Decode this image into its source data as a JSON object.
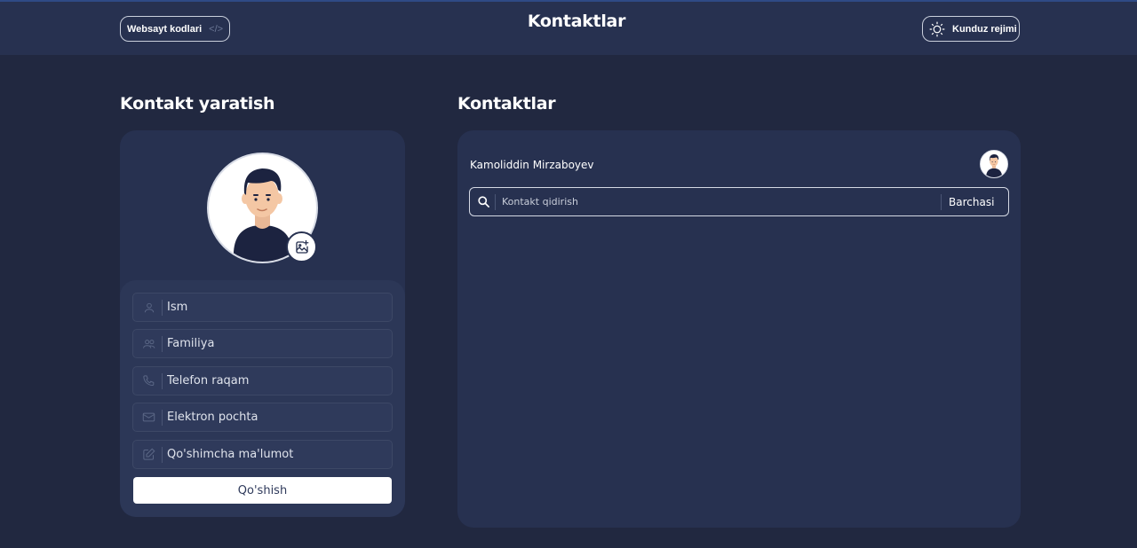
{
  "header": {
    "title": "Kontaktlar",
    "code_button_label": "Websayt kodlari",
    "code_icon": "</>",
    "day_mode_label": "Kunduz rejimi"
  },
  "create": {
    "title": "Kontakt yaratish",
    "fields": [
      {
        "placeholder": "Ism",
        "icon": "user-icon",
        "value": ""
      },
      {
        "placeholder": "Familiya",
        "icon": "users-icon",
        "value": ""
      },
      {
        "placeholder": "Telefon raqam",
        "icon": "phone-icon",
        "value": ""
      },
      {
        "placeholder": "Elektron pochta",
        "icon": "mail-icon",
        "value": ""
      },
      {
        "placeholder": "Qo'shimcha ma'lumot",
        "icon": "edit-icon",
        "value": ""
      }
    ],
    "submit_label": "Qo'shish"
  },
  "contacts": {
    "title": "Kontaktlar",
    "user_name": "Kamoliddin Mirzaboyev",
    "search_placeholder": "Kontakt qidirish",
    "filter_label": "Barchasi"
  },
  "colors": {
    "page_bg": "#212840",
    "header_bg": "#273150",
    "card_bg": "#273150",
    "form_bg": "#2c3757"
  }
}
